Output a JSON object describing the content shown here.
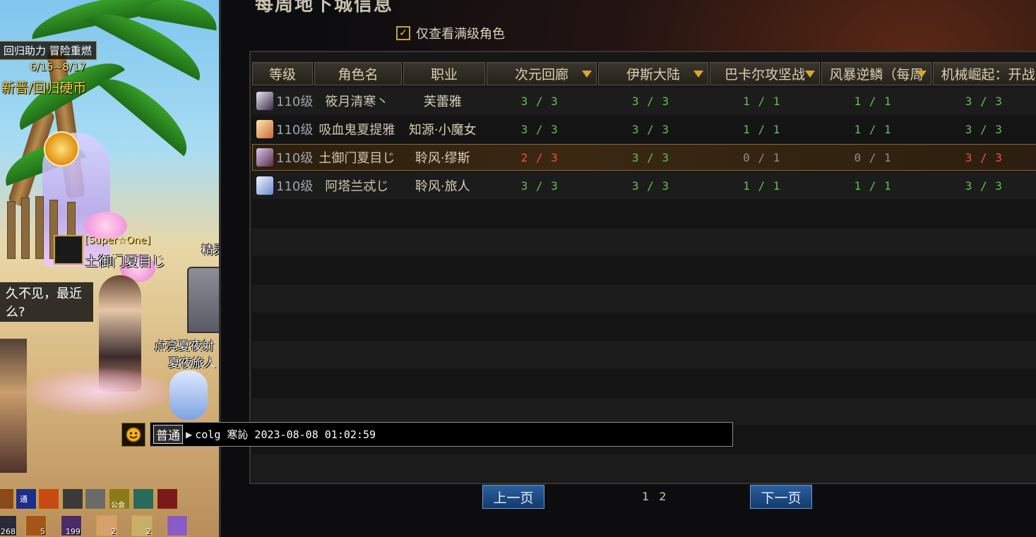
{
  "scene": {
    "event_title": "回归助力 冒险重燃",
    "event_dates": "6/15~8/17",
    "event_coin": "新晋/回归硬币",
    "player_guild": "[Super☆One]",
    "player_name": "土御门夏目じ",
    "chat_bubble_line1": "久不见，最近",
    "chat_bubble_line2": "么?",
    "npc_name_1": "点亮夏夜射",
    "npc_name_2": "夏夜旅人",
    "npc_name_top": "精灵",
    "hotbar_top": [
      "",
      "通",
      "",
      "",
      "",
      "公会",
      "",
      ""
    ],
    "hotbar_bottom_counts": [
      "268",
      "5",
      "199",
      "2",
      "2",
      ""
    ]
  },
  "panel": {
    "title": "每周地下城信息",
    "filter_label": "仅查看满级角色",
    "filter_checked": true,
    "columns": [
      "等级",
      "角色名",
      "职业",
      "次元回廊",
      "伊斯大陆",
      "巴卡尔攻坚战",
      "风暴逆鳞（每周",
      "机械崛起：开战"
    ],
    "rows": [
      {
        "level": "110级",
        "name": "筱月清寒丶",
        "job": "芙蕾雅",
        "d1": "3 / 3",
        "d2": "3 / 3",
        "d3": "1 / 1",
        "d4": "1 / 1",
        "d5": "3 / 3",
        "states": [
          "green",
          "green",
          "green",
          "green",
          "green"
        ]
      },
      {
        "level": "110级",
        "name": "吸血鬼夏提雅",
        "job": "知源·小魔女",
        "d1": "3 / 3",
        "d2": "3 / 3",
        "d3": "1 / 1",
        "d4": "1 / 1",
        "d5": "3 / 3",
        "states": [
          "green",
          "green",
          "green",
          "green",
          "green"
        ]
      },
      {
        "level": "110级",
        "name": "土御门夏目じ",
        "job": "聆风·缪斯",
        "d1": "2 / 3",
        "d2": "3 / 3",
        "d3": "0 / 1",
        "d4": "0 / 1",
        "d5": "3 / 3",
        "states": [
          "red",
          "green",
          "grey",
          "grey",
          "red"
        ]
      },
      {
        "level": "110级",
        "name": "阿塔兰忒じ",
        "job": "聆风·旅人",
        "d1": "3 / 3",
        "d2": "3 / 3",
        "d3": "1 / 1",
        "d4": "1 / 1",
        "d5": "3 / 3",
        "states": [
          "green",
          "green",
          "green",
          "green",
          "green"
        ]
      }
    ],
    "prev_label": "上一页",
    "next_label": "下一页",
    "pages": [
      "1",
      "2"
    ]
  },
  "chat": {
    "channel": "普通",
    "text": "colg 寒訫 2023-08-08 01:02:59"
  },
  "colors": {
    "green": "#5fc24e",
    "red": "#ff4a3a",
    "grey": "#8e8e8e",
    "button_blue": "#2b5f9e"
  }
}
